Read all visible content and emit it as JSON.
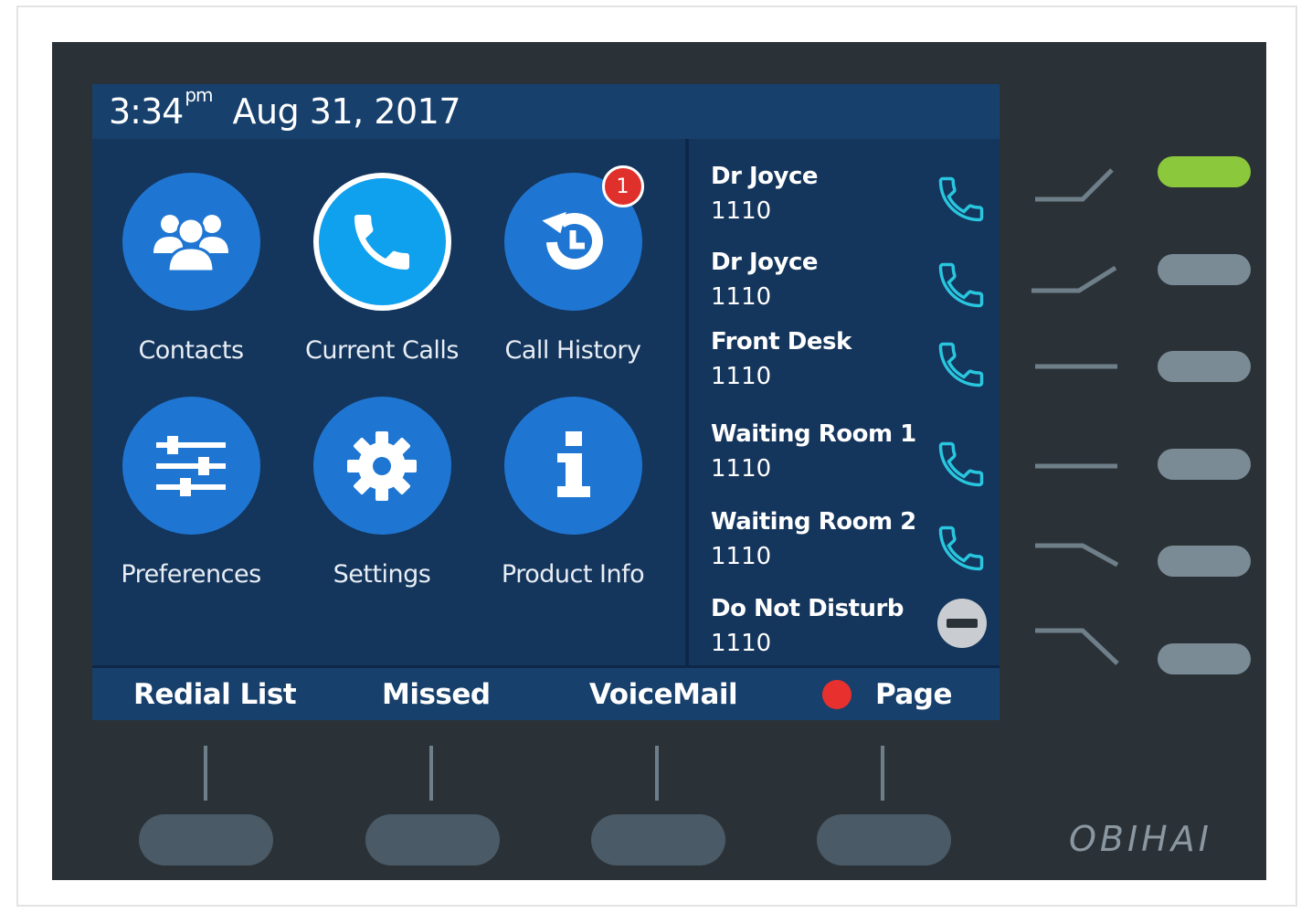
{
  "status": {
    "time": "3:34",
    "ampm": "pm",
    "date": "Aug 31, 2017"
  },
  "apps": [
    {
      "label": "Contacts",
      "icon": "contacts-icon"
    },
    {
      "label": "Current Calls",
      "icon": "phone-icon"
    },
    {
      "label": "Call History",
      "icon": "history-icon",
      "badge": "1"
    },
    {
      "label": "Preferences",
      "icon": "sliders-icon"
    },
    {
      "label": "Settings",
      "icon": "gear-icon"
    },
    {
      "label": "Product Info",
      "icon": "info-icon"
    }
  ],
  "lines": [
    {
      "name": "Dr Joyce",
      "number": "1110",
      "icon": "phone-icon"
    },
    {
      "name": "Dr Joyce",
      "number": "1110",
      "icon": "phone-icon"
    },
    {
      "name": "Front Desk",
      "number": "1110",
      "icon": "phone-icon"
    },
    {
      "name": "Waiting Room 1",
      "number": "1110",
      "icon": "phone-icon"
    },
    {
      "name": "Waiting Room 2",
      "number": "1110",
      "icon": "phone-icon"
    },
    {
      "name": "Do Not Disturb",
      "number": "1110",
      "icon": "do-not-disturb-icon"
    }
  ],
  "softkeys": [
    "Redial List",
    "Missed",
    "VoiceMail",
    "Page"
  ],
  "brand": "OBIHAI",
  "colors": {
    "screen": "#14355c",
    "bar": "#17406c",
    "app_blue": "#1f76d2",
    "active_blue": "#0fa0ee",
    "line_icon": "#29c6df",
    "badge_red": "#e0302c",
    "led_green": "#8cc83c",
    "device": "#2b3237"
  }
}
